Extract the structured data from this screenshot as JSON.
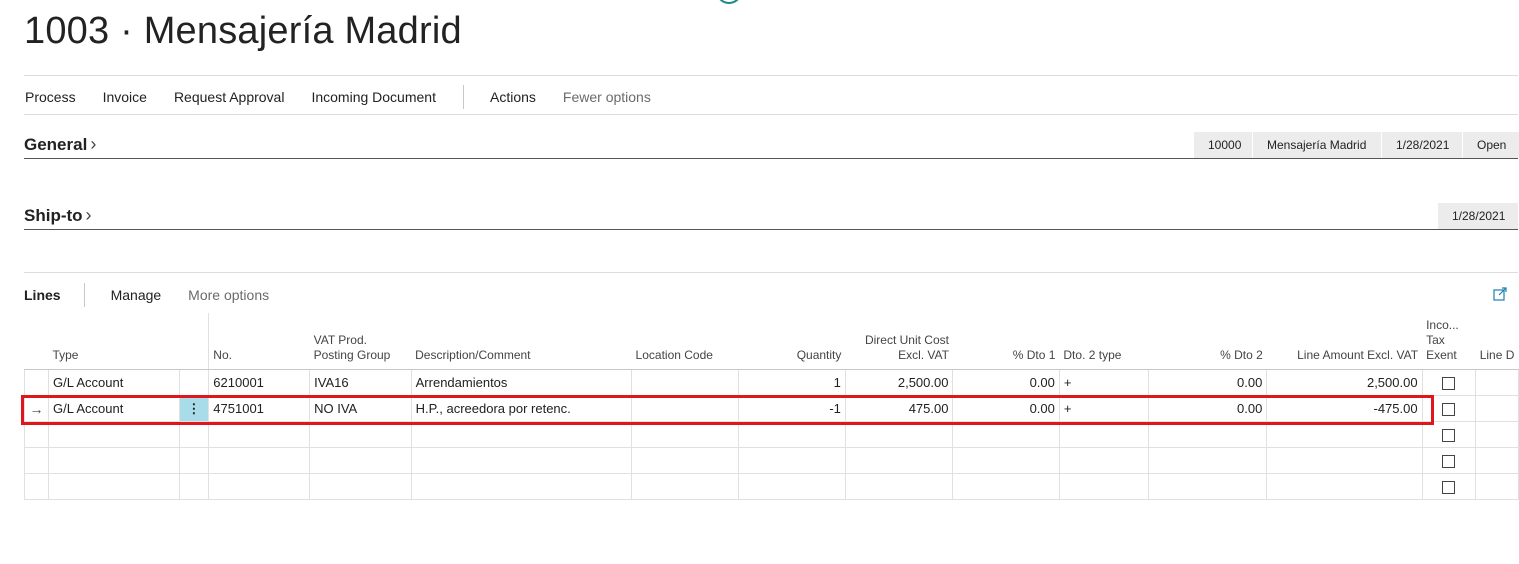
{
  "page": {
    "title": "1003 · Mensajería Madrid"
  },
  "actions": {
    "process": "Process",
    "invoice": "Invoice",
    "request_approval": "Request Approval",
    "incoming_document": "Incoming Document",
    "actions": "Actions",
    "fewer_options": "Fewer options"
  },
  "general": {
    "title": "General",
    "summary": [
      "10000",
      "Mensajería Madrid",
      "1/28/2021",
      "Open"
    ]
  },
  "ship_to": {
    "title": "Ship-to",
    "summary": [
      "1/28/2021"
    ]
  },
  "lines": {
    "title": "Lines",
    "manage": "Manage",
    "more_options": "More options",
    "columns": {
      "type": "Type",
      "no": "No.",
      "vat1": "VAT Prod.",
      "vat2": "Posting Group",
      "description": "Description/Comment",
      "location": "Location Code",
      "quantity": "Quantity",
      "cost1": "Direct Unit Cost",
      "cost2": "Excl. VAT",
      "dto1": "% Dto 1",
      "dto2type": "Dto. 2 type",
      "dto2": "% Dto 2",
      "amount": "Line Amount Excl. VAT",
      "tax1": "Inco...",
      "tax2": "Tax",
      "tax3": "Exent",
      "line_d": "Line D"
    },
    "rows": [
      {
        "type": "G/L Account",
        "no": "6210001",
        "vat": "IVA16",
        "description": "Arrendamientos",
        "location": "",
        "quantity": "1",
        "cost": "2,500.00",
        "dto1": "0.00",
        "dto2type": "+",
        "dto2": "0.00",
        "amount": "2,500.00"
      },
      {
        "type": "G/L Account",
        "no": "4751001",
        "vat": "NO IVA",
        "description": "H.P., acreedora por retenc.",
        "location": "",
        "quantity": "-1",
        "cost": "475.00",
        "dto1": "0.00",
        "dto2type": "+",
        "dto2": "0.00",
        "amount": "-475.00"
      }
    ]
  },
  "icons": {
    "current_row": "arrow-right-icon",
    "row_menu": "more-vertical-icon",
    "expand": "expand-icon"
  },
  "colors": {
    "highlight": "#e0161f",
    "row_menu_bg": "#a8dce9",
    "accent": "#1a8a8a"
  }
}
